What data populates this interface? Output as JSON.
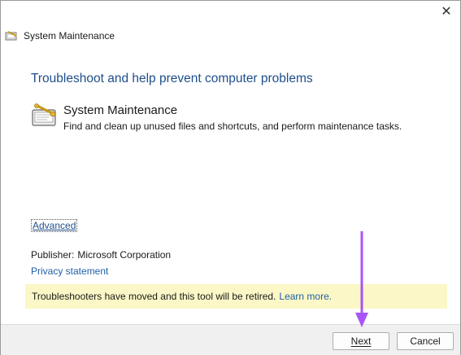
{
  "window": {
    "title": "System Maintenance",
    "close_symbol": "✕"
  },
  "heading": "Troubleshoot and help prevent computer problems",
  "tool": {
    "name": "System Maintenance",
    "description": "Find and clean up unused files and shortcuts, and perform maintenance tasks.",
    "icon": "maintenance-tool-icon"
  },
  "advanced_link": "Advanced",
  "publisher": {
    "label": "Publisher:",
    "value": "Microsoft Corporation"
  },
  "privacy_link": "Privacy statement",
  "notice": {
    "text": "Troubleshooters have moved and this tool will be retired.",
    "link": "Learn more."
  },
  "footer": {
    "next_label": "Next",
    "cancel_label": "Cancel"
  },
  "colors": {
    "heading": "#1f4e8c",
    "link": "#1f5fa8",
    "notice_bg": "#fbf7c6",
    "annotation_arrow": "#a855f7"
  }
}
